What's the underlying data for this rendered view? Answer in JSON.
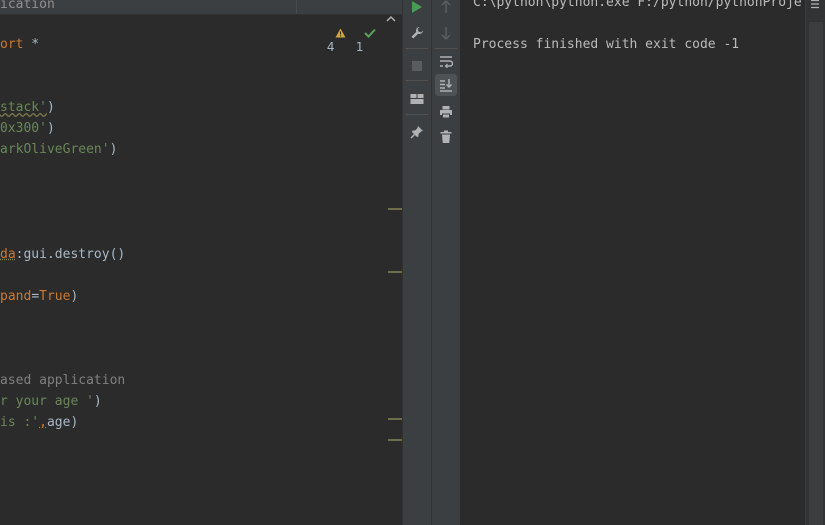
{
  "editor": {
    "tab_title": "ication",
    "inspections": {
      "warnings": "4",
      "ok": "1"
    },
    "code": {
      "l1": "ort",
      "l1b": " *",
      "l2a": "stack'",
      "l2b": ")",
      "l3a": "0x300'",
      "l3b": ")",
      "l4a": "arkOliveGreen'",
      "l4b": ")",
      "l5a": "da",
      "l5b": ":gui.destroy()",
      "l6a": "pand",
      "l6b": "=",
      "l6c": "True",
      "l6d": ")",
      "l7": "ased application",
      "l8a": "r your age '",
      "l8b": ")",
      "l9a": "is :'",
      "l9b": ",",
      "l9c": "age)"
    }
  },
  "run_toolbar": {
    "left": [
      "run-icon",
      "wrench-icon",
      "stop-icon",
      "layout-icon",
      "pin-icon"
    ],
    "right": [
      "up-arrow-icon",
      "down-arrow-icon",
      "soft-wrap-icon",
      "scroll-to-end-icon",
      "print-icon",
      "trash-icon"
    ]
  },
  "console": {
    "command_line": "C:\\python\\python.exe F:/python/pythonProje",
    "exit_line": "Process finished with exit code -1"
  },
  "colors": {
    "background": "#2b2b2b",
    "toolbar": "#3c3f41",
    "keyword": "#cc7832",
    "string": "#6a8759",
    "comment": "#808080",
    "run_green": "#499c54"
  }
}
